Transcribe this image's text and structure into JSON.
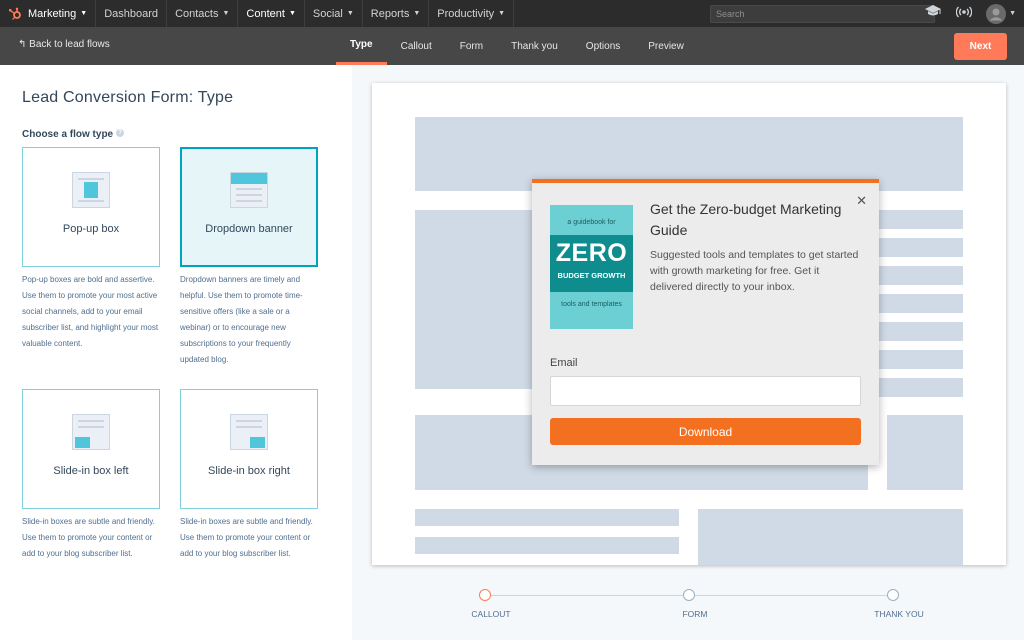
{
  "topnav": {
    "brand": "Marketing",
    "items": [
      {
        "label": "Dashboard",
        "caret": false
      },
      {
        "label": "Contacts",
        "caret": true
      },
      {
        "label": "Content",
        "caret": true,
        "active": true
      },
      {
        "label": "Social",
        "caret": true
      },
      {
        "label": "Reports",
        "caret": true
      },
      {
        "label": "Productivity",
        "caret": true
      }
    ],
    "search_placeholder": "Search",
    "icons": [
      "academy-icon",
      "notifications-icon",
      "user-avatar"
    ]
  },
  "subbar": {
    "back_label": "Back to lead flows",
    "tabs": [
      "Type",
      "Callout",
      "Form",
      "Thank you",
      "Options",
      "Preview"
    ],
    "active_tab": "Type",
    "next_label": "Next"
  },
  "left": {
    "title": "Lead Conversion Form: Type",
    "choose_label": "Choose a flow type",
    "cards": [
      {
        "label": "Pop-up box",
        "description": "Pop-up boxes are bold and assertive. Use them to promote your most active social channels, add to your email subscriber list, and highlight your most valuable content."
      },
      {
        "label": "Dropdown banner",
        "description": "Dropdown banners are timely and helpful. Use them to promote time-sensitive offers (like a sale or a webinar) or to encourage new subscriptions to your frequently updated blog.",
        "selected": true
      },
      {
        "label": "Slide-in box left",
        "description": "Slide-in boxes are subtle and friendly. Use them to promote your content or add to your blog subscriber list."
      },
      {
        "label": "Slide-in box right",
        "description": "Slide-in boxes are subtle and friendly. Use them to promote your content or add to your blog subscriber list."
      }
    ]
  },
  "popup": {
    "book_top": "a guidebook for",
    "book_big": "ZERO",
    "book_sub": "BUDGET GROWTH",
    "book_bottom": "tools and templates",
    "heading": "Get the Zero-budget Marketing Guide",
    "body": "Suggested tools and templates to get started with growth marketing for free. Get it delivered directly to your inbox.",
    "email_label": "Email",
    "email_value": "",
    "button_label": "Download",
    "close_icon": "close-icon"
  },
  "stepper": {
    "steps": [
      "CALLOUT",
      "FORM",
      "THANK YOU"
    ],
    "active_step": "CALLOUT"
  },
  "colors": {
    "accent": "#ff7a59",
    "teal": "#00a4bd",
    "popup_orange": "#f37021"
  }
}
